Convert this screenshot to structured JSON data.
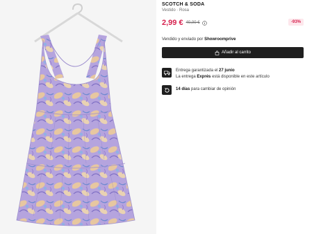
{
  "product": {
    "brand": "SCOTCH & SODA",
    "subtitle": "Vestido · Rosa",
    "price": "2,99 €",
    "old_price": "40,00 €",
    "discount": "-93%",
    "seller_prefix": "Vendido y enviado por",
    "seller_name": "Showroomprive",
    "cart_label": "Añadir al carrito"
  },
  "delivery": {
    "guarantee_prefix": "Entrega garantizada el",
    "guarantee_date": "27 junio",
    "express_prefix": "La entrega",
    "express_word": "Exprés",
    "express_suffix": "está disponible en este artículo"
  },
  "returns": {
    "days": "14 días",
    "text": "para cambiar de opinión"
  },
  "colors": {
    "price": "#d6204d",
    "button": "#1f1f1f",
    "dress_base": "#a99ad8",
    "dress_accent": "#e7c7a0"
  },
  "icons": [
    "hanger-icon",
    "info-icon",
    "bag-icon",
    "truck-icon",
    "return-icon"
  ]
}
